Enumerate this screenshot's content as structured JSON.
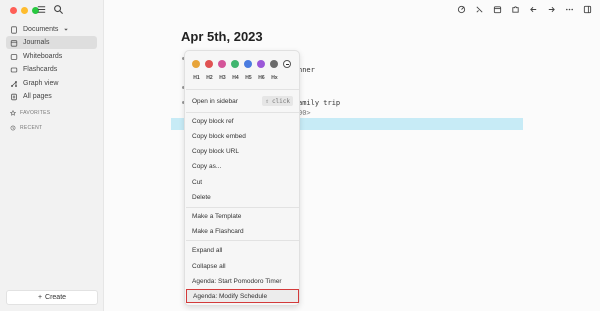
{
  "sidebar": {
    "items": [
      {
        "label": "Documents",
        "icon": "document-icon"
      },
      {
        "label": "Journals",
        "icon": "calendar-icon"
      },
      {
        "label": "Whiteboards",
        "icon": "whiteboard-icon"
      },
      {
        "label": "Flashcards",
        "icon": "flashcard-icon"
      },
      {
        "label": "Graph view",
        "icon": "graph-icon"
      },
      {
        "label": "All pages",
        "icon": "pages-icon"
      }
    ],
    "favorites_label": "FAVORITES",
    "recent_label": "RECENT",
    "create_label": "Create",
    "create_icon": "+"
  },
  "page": {
    "title": "Apr 5th, 2023",
    "frag1": "nner",
    "frag2": "amily trip",
    "frag3": "00>"
  },
  "colors": [
    "#e7a43a",
    "#e05252",
    "#d45599",
    "#3fb56e",
    "#4a7ce0",
    "#9b58d8",
    "#6b6b6b"
  ],
  "headings": [
    "H1",
    "H2",
    "H3",
    "H4",
    "H5",
    "H6",
    "Hx"
  ],
  "menu": {
    "open_sidebar": "Open in sidebar",
    "shortcut_key": "⇧",
    "shortcut_text": "click",
    "copy_ref": "Copy block ref",
    "copy_embed": "Copy block embed",
    "copy_url": "Copy block URL",
    "copy_as": "Copy as...",
    "cut": "Cut",
    "delete": "Delete",
    "make_template": "Make a Template",
    "make_flashcard": "Make a Flashcard",
    "expand_all": "Expand all",
    "collapse_all": "Collapse all",
    "agenda_pomodoro": "Agenda: Start Pomodoro Timer",
    "agenda_modify": "Agenda: Modify Schedule"
  }
}
